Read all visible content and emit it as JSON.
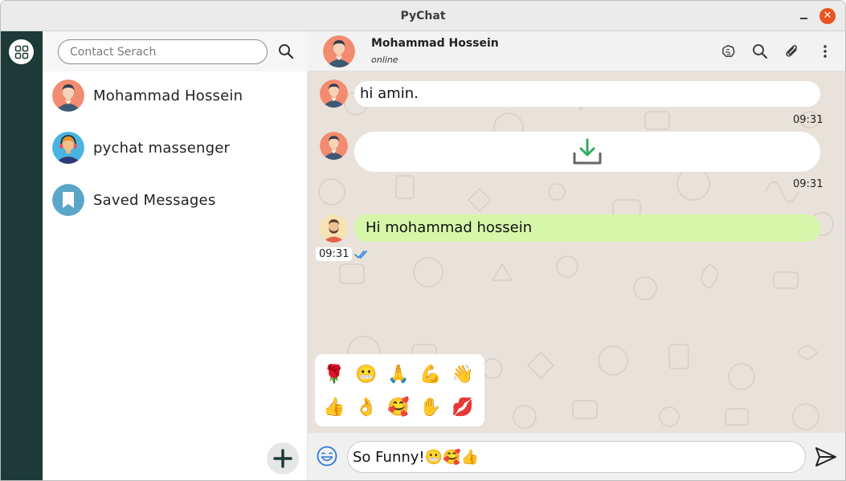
{
  "window": {
    "title": "PyChat",
    "close_glyph": "✕"
  },
  "contacts": {
    "search_placeholder": "Contact Serach",
    "items": [
      {
        "name": "Mohammad Hossein",
        "avatar": "man-avatar-icon"
      },
      {
        "name": "pychat massenger",
        "avatar": "support-agent-avatar-icon"
      },
      {
        "name": "Saved Messages",
        "avatar": "bookmark-icon"
      }
    ]
  },
  "chat": {
    "peer_name": "Mohammad Hossein",
    "peer_status": "online",
    "messages": [
      {
        "type": "text",
        "direction": "in",
        "text": "hi amin.",
        "time": "09:31"
      },
      {
        "type": "file",
        "direction": "in",
        "icon": "download-icon",
        "time": "09:31"
      },
      {
        "type": "text",
        "direction": "out",
        "text": "Hi mohammad hossein",
        "time": "09:31",
        "status": "read"
      }
    ],
    "emoji_panel": [
      "🌹",
      "😬",
      "🙏",
      "💪",
      "👋",
      "👍",
      "👌",
      "🥰",
      "✋",
      "💋"
    ],
    "composer_value": "So Funny!😬🥰👍"
  },
  "colors": {
    "rail": "#1d3a36",
    "chat_background": "#e9e2da",
    "outgoing_bubble": "#d6f7a9",
    "close_button": "#e95420",
    "read_check": "#3b8fe0",
    "download_arrow": "#2fae5b"
  }
}
